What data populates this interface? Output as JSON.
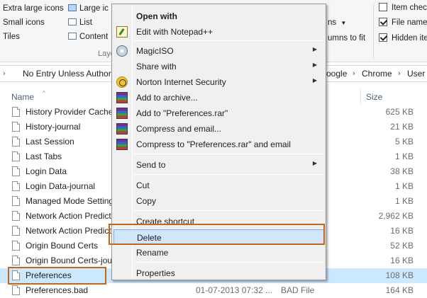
{
  "ribbon": {
    "layout": {
      "extra_large_icons": "Extra large icons",
      "large_icons": "Large ic",
      "small_icons": "Small icons",
      "list": "List",
      "tiles": "Tiles",
      "content": "Content",
      "group_label": "Layo"
    },
    "view": {
      "dropdown_label": "ns",
      "fit_columns": "umns to fit"
    },
    "show_hide": {
      "item_check_boxes": {
        "label": "Item check",
        "checked": false
      },
      "file_name_extensions": {
        "label": "File name",
        "checked": true
      },
      "hidden_items": {
        "label": "Hidden ite",
        "checked": true
      }
    }
  },
  "address_bar": {
    "left_segment": "No Entry Unless Author",
    "right_segments": [
      "oogle",
      "Chrome",
      "User"
    ]
  },
  "columns": {
    "name": "Name",
    "size": "Size"
  },
  "files": [
    {
      "name": "History Provider Cache",
      "date": "",
      "type": "",
      "size": "625 KB",
      "selected": false
    },
    {
      "name": "History-journal",
      "date": "",
      "type": "",
      "size": "21 KB",
      "selected": false
    },
    {
      "name": "Last Session",
      "date": "",
      "type": "",
      "size": "5 KB",
      "selected": false
    },
    {
      "name": "Last Tabs",
      "date": "",
      "type": "",
      "size": "1 KB",
      "selected": false
    },
    {
      "name": "Login Data",
      "date": "",
      "type": "",
      "size": "38 KB",
      "selected": false
    },
    {
      "name": "Login Data-journal",
      "date": "",
      "type": "",
      "size": "1 KB",
      "selected": false
    },
    {
      "name": "Managed Mode Settings",
      "date": "",
      "type": "",
      "size": "1 KB",
      "selected": false
    },
    {
      "name": "Network Action Predictor",
      "date": "",
      "type": "",
      "size": "2,962 KB",
      "selected": false
    },
    {
      "name": "Network Action Predictor-journal",
      "date": "",
      "type": "",
      "size": "16 KB",
      "selected": false
    },
    {
      "name": "Origin Bound Certs",
      "date": "",
      "type": "",
      "size": "52 KB",
      "selected": false
    },
    {
      "name": "Origin Bound Certs-journal",
      "date": "",
      "type": "",
      "size": "16 KB",
      "selected": false
    },
    {
      "name": "Preferences",
      "date": "",
      "type": "",
      "size": "108 KB",
      "selected": true
    },
    {
      "name": "Preferences.bad",
      "date": "01-07-2013 07:32 ...",
      "type": "BAD File",
      "size": "164 KB",
      "selected": false
    }
  ],
  "context_menu": {
    "items": [
      {
        "label": "Open with",
        "bold": true,
        "icon": "",
        "submenu": false
      },
      {
        "label": "Edit with Notepad++",
        "icon": "notepad-plus-plus-icon",
        "submenu": false
      },
      {
        "label": "MagicISO",
        "icon": "magiciso-icon",
        "submenu": true
      },
      {
        "label": "Share with",
        "icon": "",
        "submenu": true
      },
      {
        "label": "Norton Internet Security",
        "icon": "norton-icon",
        "submenu": true
      },
      {
        "label": "Add to archive...",
        "icon": "winrar-icon",
        "submenu": false
      },
      {
        "label": "Add to \"Preferences.rar\"",
        "icon": "winrar-icon",
        "submenu": false
      },
      {
        "label": "Compress and email...",
        "icon": "winrar-icon",
        "submenu": false
      },
      {
        "label": "Compress to \"Preferences.rar\" and email",
        "icon": "winrar-icon",
        "submenu": false
      },
      {
        "label": "Send to",
        "icon": "",
        "submenu": true
      },
      {
        "label": "Cut",
        "icon": "",
        "submenu": false
      },
      {
        "label": "Copy",
        "icon": "",
        "submenu": false
      },
      {
        "label": "Create shortcut",
        "icon": "",
        "submenu": false
      },
      {
        "label": "Delete",
        "icon": "",
        "submenu": false,
        "hovered": true
      },
      {
        "label": "Rename",
        "icon": "",
        "submenu": false
      },
      {
        "label": "Properties",
        "icon": "",
        "submenu": false
      }
    ],
    "submenu_arrow": "▶"
  },
  "colors": {
    "highlight_outline": "#c5671a",
    "selection": "#cce8ff",
    "menu_hover": "#d1e5fb"
  }
}
